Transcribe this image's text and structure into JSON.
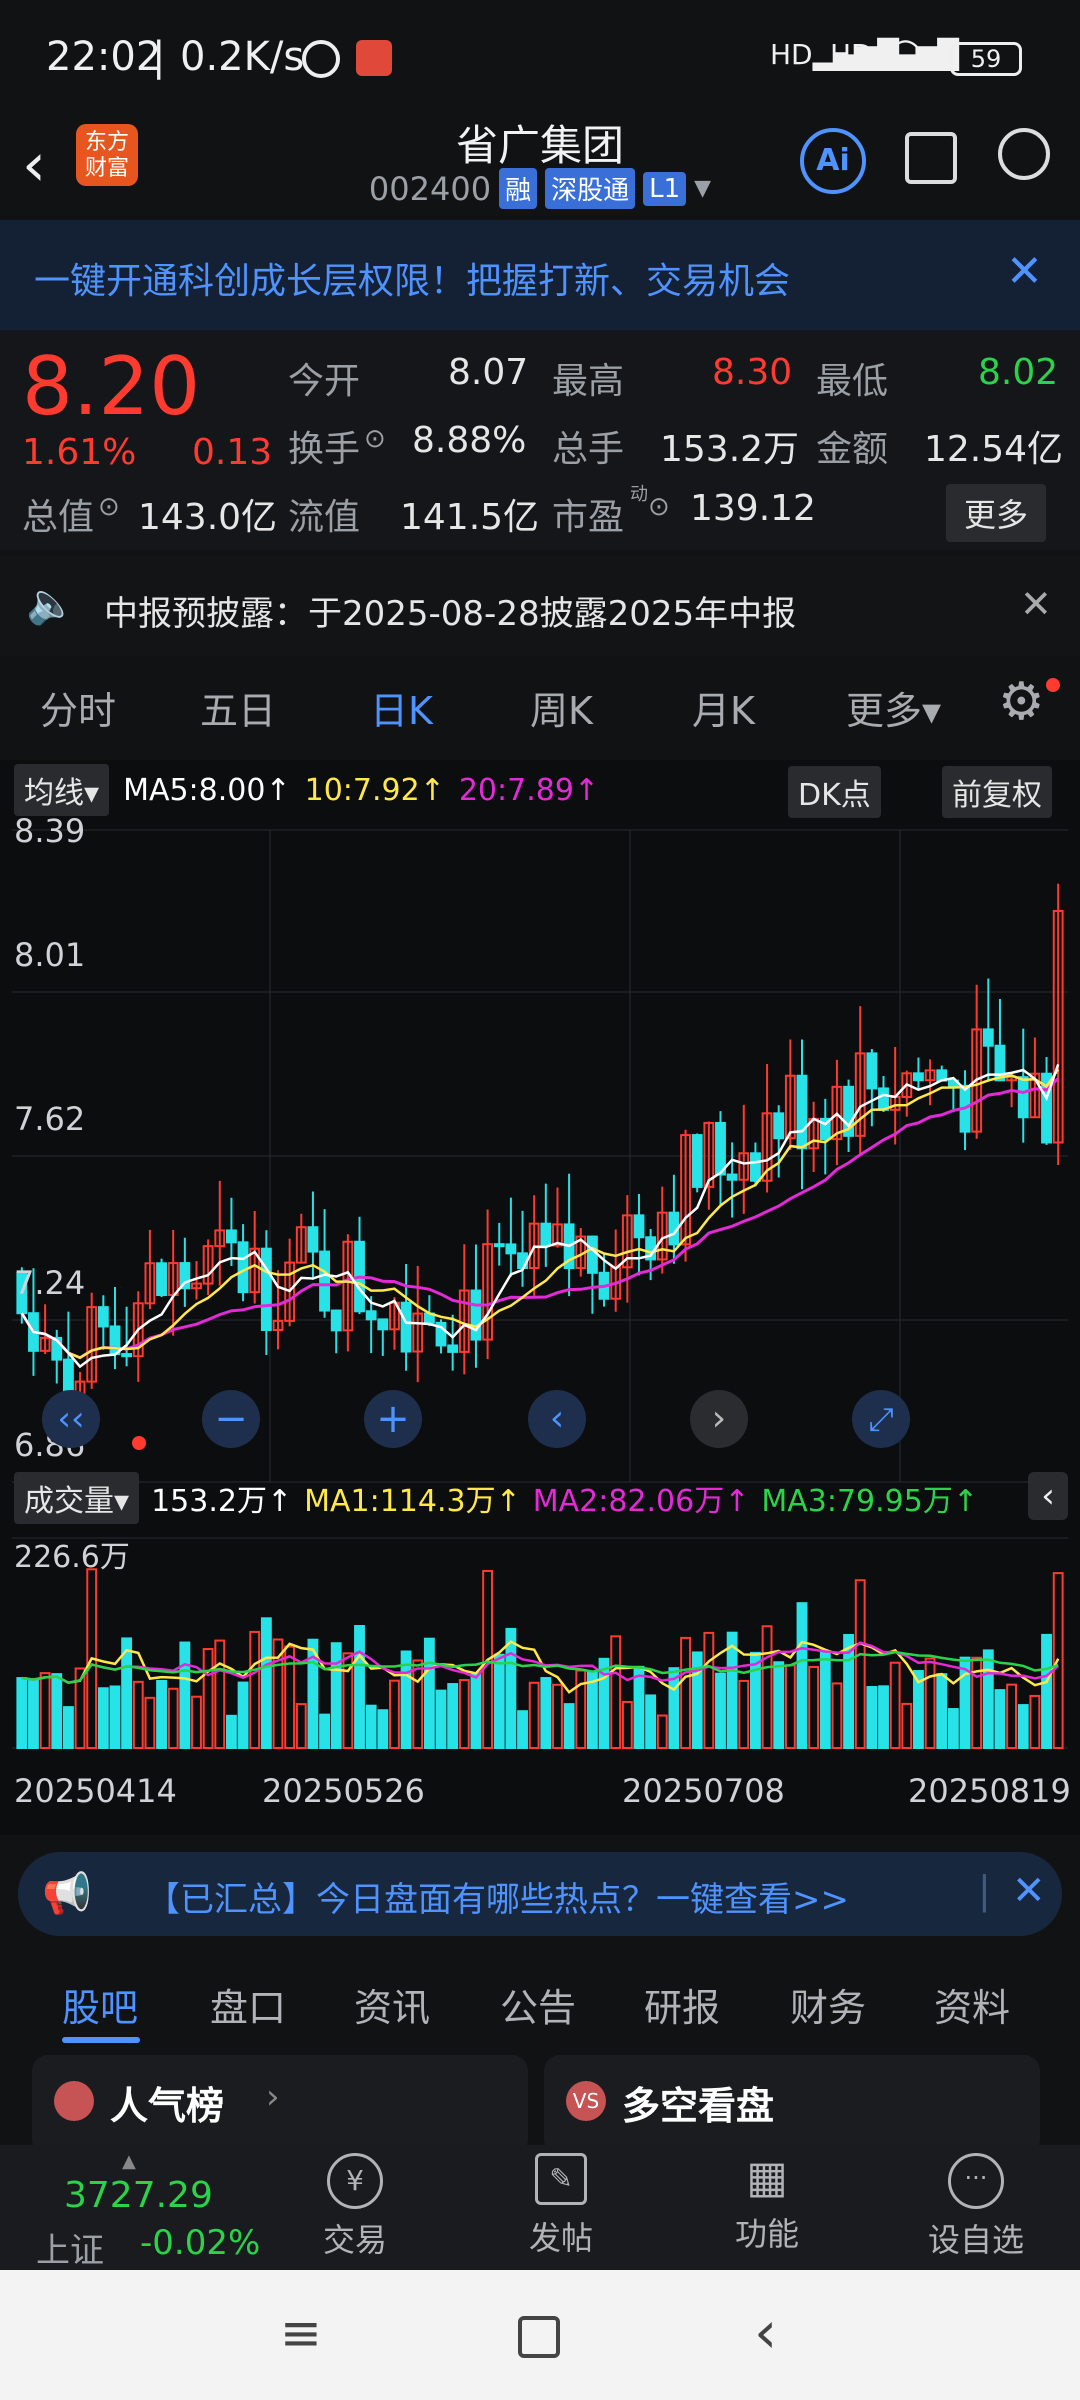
{
  "status": {
    "time": "22:02",
    "net_speed": "0.2K/s",
    "battery": "59"
  },
  "header": {
    "logo": "东方\n财富",
    "stock_name": "省广集团",
    "code": "002400",
    "tags": [
      "融",
      "深股通",
      "L1"
    ],
    "ai_label": "Ai"
  },
  "banner": {
    "text": "一键开通科创成长层权限！把握打新、交易机会"
  },
  "quote": {
    "price": "8.20",
    "change_pct": "1.61%",
    "change": "0.13",
    "open_label": "今开",
    "open": "8.07",
    "high_label": "最高",
    "high": "8.30",
    "low_label": "最低",
    "low": "8.02",
    "turnover_label": "换手",
    "turnover": "8.88%",
    "volume_label": "总手",
    "volume": "153.2万",
    "amount_label": "金额",
    "amount": "12.54亿",
    "mktcap_label": "总值",
    "mktcap": "143.0亿",
    "float_label": "流值",
    "float_cap": "141.5亿",
    "pe_label": "市盈",
    "pe_sup": "动",
    "pe": "139.12",
    "more": "更多"
  },
  "notice": {
    "text": "中报预披露：于2025-08-28披露2025年中报"
  },
  "chart_tabs": [
    "分时",
    "五日",
    "日K",
    "周K",
    "月K",
    "更多"
  ],
  "chart_tab_active": 2,
  "kline": {
    "ma_selector": "均线",
    "ma5": "MA5:8.00↑",
    "ma10": "10:7.92↑",
    "ma20": "20:7.89↑",
    "dk_button": "DK点",
    "adjust_button": "前复权",
    "price_ticks": [
      "8.39",
      "8.01",
      "7.62",
      "7.24",
      "6.86"
    ]
  },
  "volume_panel": {
    "selector": "成交量",
    "vol": "153.2万↑",
    "ma1": "MA1:114.3万↑",
    "ma2": "MA2:82.06万↑",
    "ma3": "MA3:79.95万↑",
    "max_label": "226.6万",
    "dates": [
      "20250414",
      "20250526",
      "20250708",
      "20250819"
    ]
  },
  "hot_banner": {
    "text": "【已汇总】今日盘面有哪些热点？一键查看>>"
  },
  "bottom_tabs": [
    "股吧",
    "盘口",
    "资讯",
    "公告",
    "研报",
    "财务",
    "资料"
  ],
  "cards": [
    "人气榜",
    "多空看盘"
  ],
  "bottom_bar": {
    "index_value": "3727.29",
    "index_name": "上证",
    "index_change": "-0.02%",
    "items": [
      "交易",
      "发帖",
      "功能",
      "设自选"
    ]
  },
  "colors": {
    "up": "#ff3b30",
    "down": "#2bd34b",
    "accent": "#4e93ff",
    "ma5": "#ffffff",
    "ma10": "#ffe94a",
    "ma20": "#e22ad6"
  }
}
